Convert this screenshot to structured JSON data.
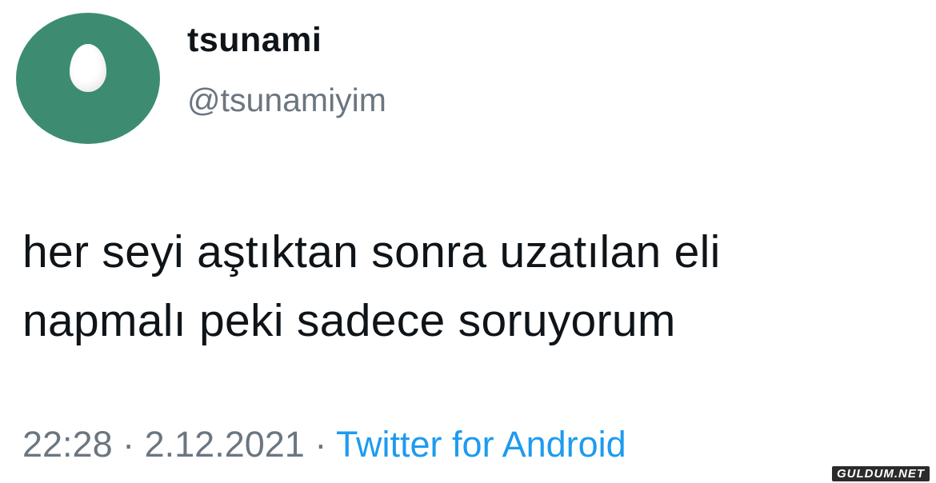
{
  "author": {
    "display_name": "tsunami",
    "handle": "@tsunamiyim",
    "avatar_icon": "default-egg-avatar-icon",
    "avatar_color": "#3d8c72"
  },
  "tweet": {
    "line1": "her seyi aştıktan sonra uzatılan eli",
    "line2": "napmalı peki sadece soruyorum"
  },
  "meta": {
    "time": "22:28",
    "separator": " · ",
    "date": "2.12.2021",
    "source": "Twitter for Android",
    "source_color": "#1d9bf0"
  },
  "watermark": {
    "text": "GULDUM.NET"
  }
}
